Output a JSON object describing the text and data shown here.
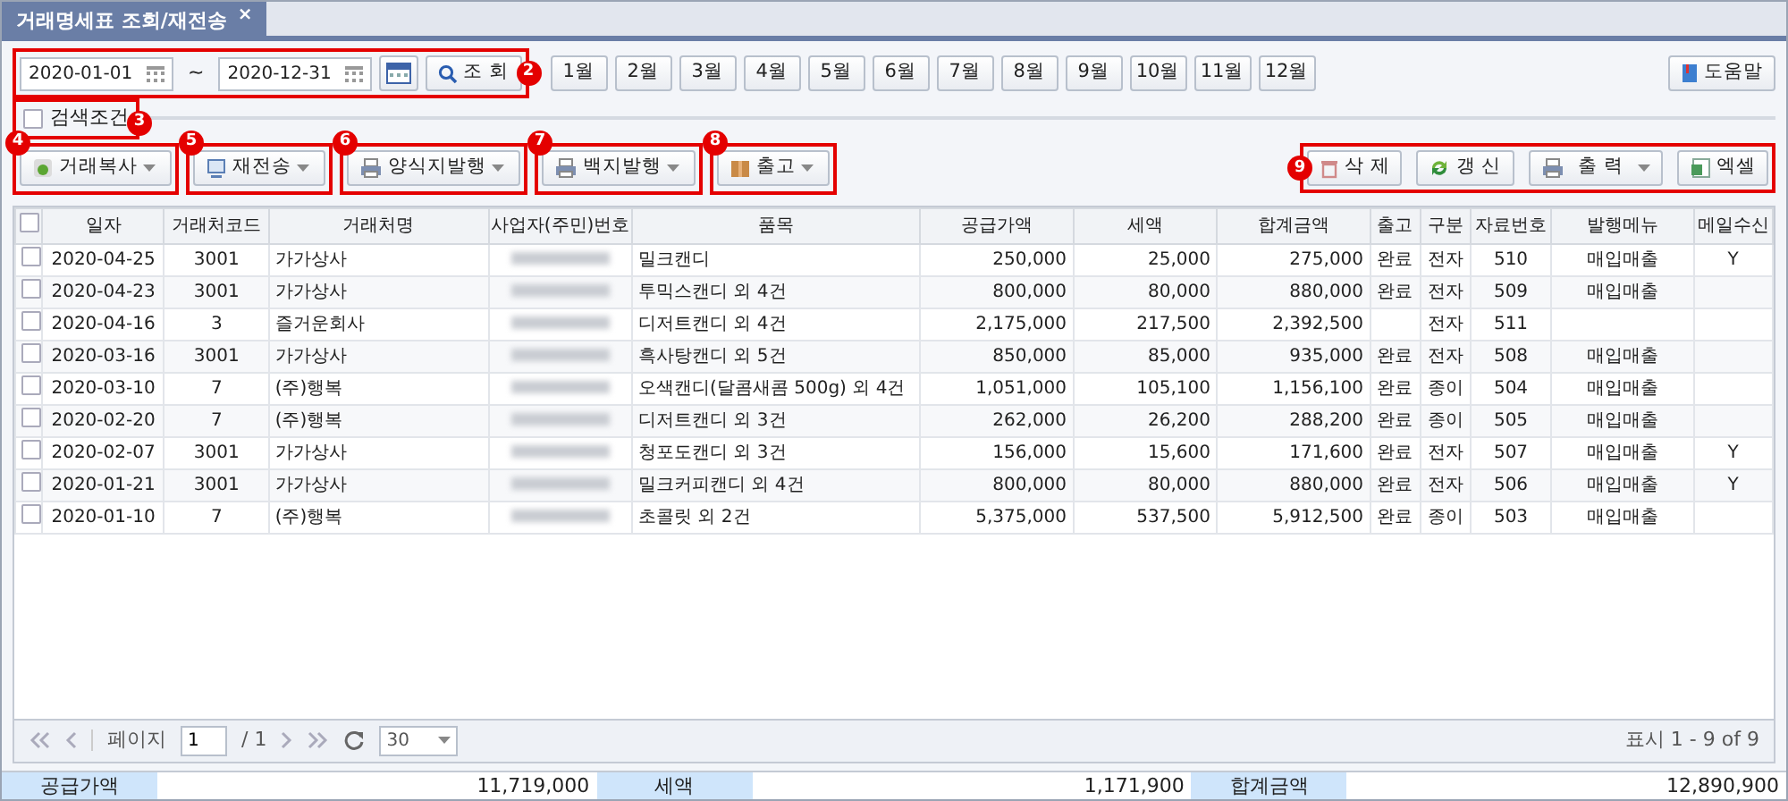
{
  "tab": {
    "title": "거래명세표 조회/재전송",
    "close": "×",
    "selected": true
  },
  "date_range": {
    "from": "2020-01-01",
    "separator": "~",
    "to": "2020-12-31",
    "search_button": "조 회",
    "callout": "2"
  },
  "months": [
    "1월",
    "2월",
    "3월",
    "4월",
    "5월",
    "6월",
    "7월",
    "8월",
    "9월",
    "10월",
    "11월",
    "12월"
  ],
  "help_button": "도움말",
  "search_conditions": {
    "label": "검색조건",
    "checked": false,
    "callout": "3"
  },
  "actions": [
    {
      "label": "거래복사",
      "callout": "4"
    },
    {
      "label": "재전송",
      "callout": "5"
    },
    {
      "label": "양식지발행",
      "callout": "6"
    },
    {
      "label": "백지발행",
      "callout": "7"
    },
    {
      "label": "출고",
      "callout": "8"
    }
  ],
  "right_actions": {
    "callout": "9",
    "buttons": [
      {
        "label": "삭 제",
        "dropdown": false
      },
      {
        "label": "갱 신",
        "dropdown": false
      },
      {
        "label": "출 력",
        "dropdown": true
      },
      {
        "label": "엑셀",
        "dropdown": false
      }
    ]
  },
  "table": {
    "all_checked": false,
    "columns": [
      "일자",
      "거래처코드",
      "거래처명",
      "사업자(주민)번호",
      "품목",
      "공급가액",
      "세액",
      "합계금액",
      "출고",
      "구분",
      "자료번호",
      "발행메뉴",
      "메일수신"
    ],
    "rows": [
      {
        "checked": false,
        "date": "2020-04-25",
        "code": "3001",
        "name": "가가상사",
        "item": "밀크캔디",
        "supply": "250,000",
        "tax": "25,000",
        "total": "275,000",
        "ship": "완료",
        "type": "전자",
        "no": "510",
        "menu": "매입매출",
        "mail": "Y"
      },
      {
        "checked": false,
        "date": "2020-04-23",
        "code": "3001",
        "name": "가가상사",
        "item": "투믹스캔디 외 4건",
        "supply": "800,000",
        "tax": "80,000",
        "total": "880,000",
        "ship": "완료",
        "type": "전자",
        "no": "509",
        "menu": "매입매출"
      },
      {
        "checked": false,
        "date": "2020-04-16",
        "code": "3",
        "name": "즐거운회사",
        "item": "디저트캔디 외 4건",
        "supply": "2,175,000",
        "tax": "217,500",
        "total": "2,392,500",
        "type": "전자",
        "no": "511"
      },
      {
        "checked": false,
        "date": "2020-03-16",
        "code": "3001",
        "name": "가가상사",
        "item": "흑사탕캔디 외 5건",
        "supply": "850,000",
        "tax": "85,000",
        "total": "935,000",
        "ship": "완료",
        "type": "전자",
        "no": "508",
        "menu": "매입매출"
      },
      {
        "checked": false,
        "date": "2020-03-10",
        "code": "7",
        "name": "(주)행복",
        "item": "오색캔디(달콤새콤 500g) 외 4건",
        "supply": "1,051,000",
        "tax": "105,100",
        "total": "1,156,100",
        "ship": "완료",
        "type": "종이",
        "no": "504",
        "menu": "매입매출"
      },
      {
        "checked": false,
        "date": "2020-02-20",
        "code": "7",
        "name": "(주)행복",
        "item": "디저트캔디 외 3건",
        "supply": "262,000",
        "tax": "26,200",
        "total": "288,200",
        "ship": "완료",
        "type": "종이",
        "no": "505",
        "menu": "매입매출"
      },
      {
        "checked": false,
        "date": "2020-02-07",
        "code": "3001",
        "name": "가가상사",
        "item": "청포도캔디 외 3건",
        "supply": "156,000",
        "tax": "15,600",
        "total": "171,600",
        "ship": "완료",
        "type": "전자",
        "no": "507",
        "menu": "매입매출",
        "mail": "Y"
      },
      {
        "checked": false,
        "date": "2020-01-21",
        "code": "3001",
        "name": "가가상사",
        "item": "밀크커피캔디 외 4건",
        "supply": "800,000",
        "tax": "80,000",
        "total": "880,000",
        "ship": "완료",
        "type": "전자",
        "no": "506",
        "menu": "매입매출",
        "mail": "Y"
      },
      {
        "checked": false,
        "date": "2020-01-10",
        "code": "7",
        "name": "(주)행복",
        "item": "초콜릿 외 2건",
        "supply": "5,375,000",
        "tax": "537,500",
        "total": "5,912,500",
        "ship": "완료",
        "type": "종이",
        "no": "503",
        "menu": "매입매출"
      }
    ]
  },
  "pager": {
    "page_label": "페이지",
    "page": "1",
    "total": "/ 1",
    "page_size": "30",
    "summary": "표시 1 - 9 of 9"
  },
  "totals": [
    {
      "label": "공급가액",
      "value": "11,719,000"
    },
    {
      "label": "세액",
      "value": "1,171,900"
    },
    {
      "label": "합계금액",
      "value": "12,890,900"
    }
  ]
}
